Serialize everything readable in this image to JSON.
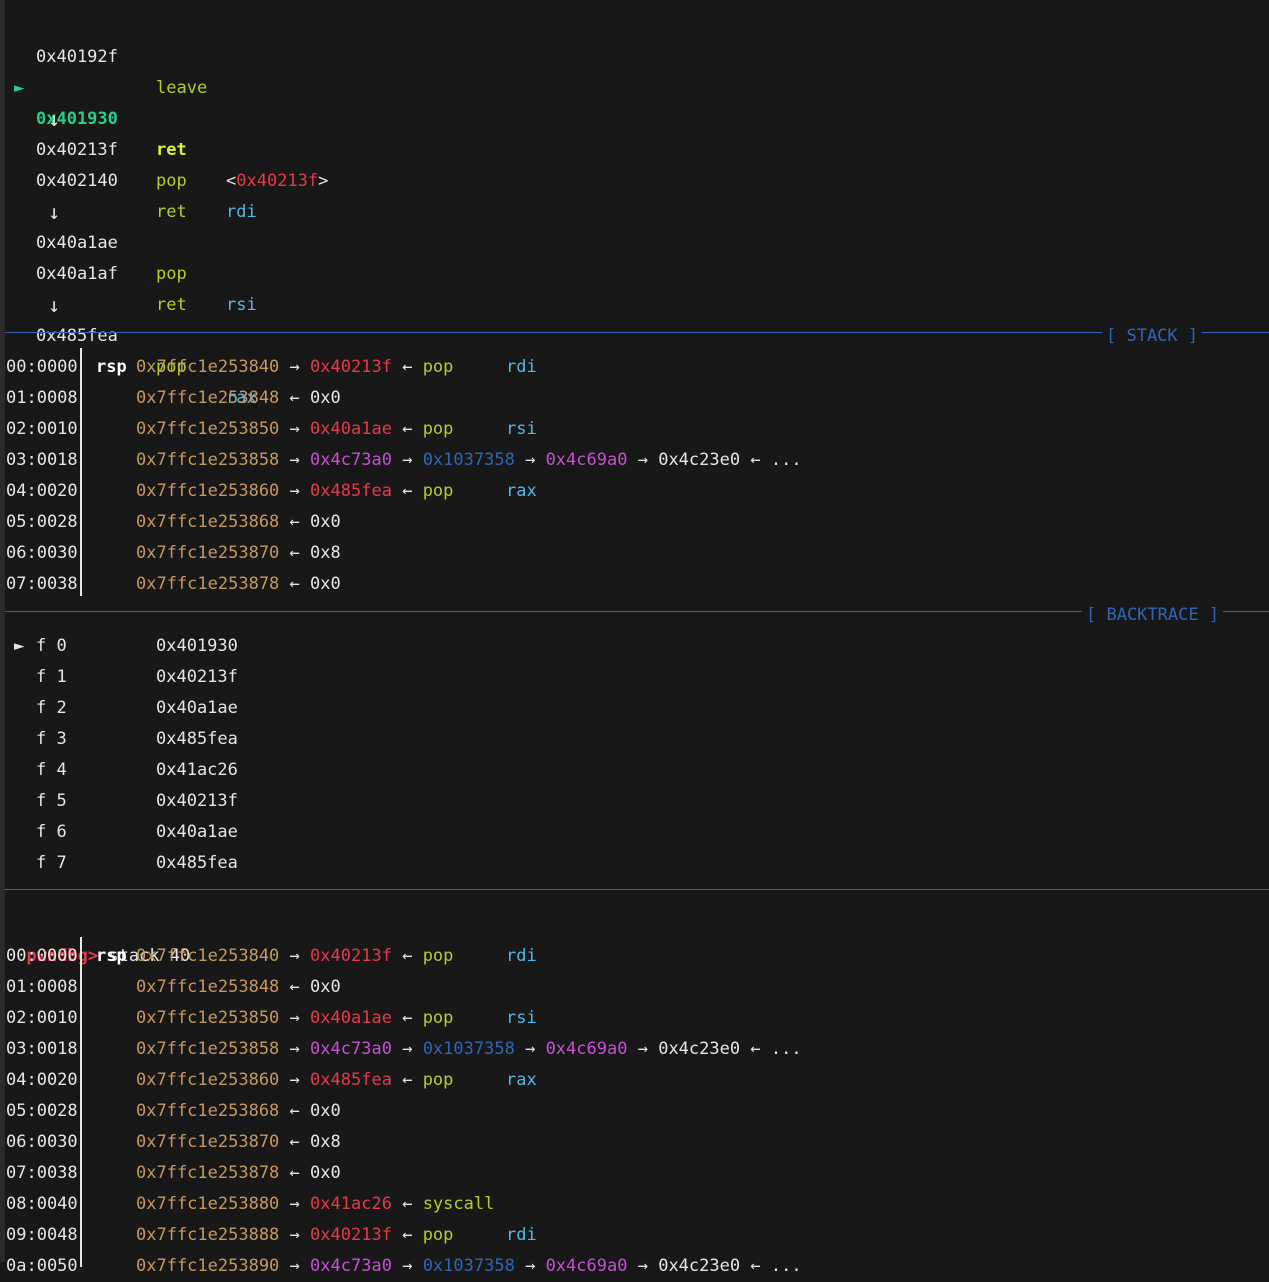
{
  "disasm": [
    {
      "addr": "0x40192f",
      "mnemonic": "leave",
      "operand": "",
      "current": false
    },
    {
      "addr": "0x401930",
      "mnemonic": "ret",
      "operand_target": "0x40213f",
      "current": true,
      "marker": "►",
      "lt": "<",
      "gt": ">"
    },
    {
      "arrow": "↓"
    },
    {
      "addr": "0x40213f",
      "mnemonic": "pop",
      "operand": "rdi"
    },
    {
      "addr": "0x402140",
      "mnemonic": "ret",
      "operand": ""
    },
    {
      "arrow": "↓"
    },
    {
      "addr": "0x40a1ae",
      "mnemonic": "pop",
      "operand": "rsi"
    },
    {
      "addr": "0x40a1af",
      "mnemonic": "ret",
      "operand": ""
    },
    {
      "arrow": "↓"
    },
    {
      "addr": "0x485fea",
      "mnemonic": "pop",
      "operand": "rax"
    }
  ],
  "sections": {
    "stack": "[ STACK ]",
    "backtrace": "[ BACKTRACE ]"
  },
  "stack": [
    {
      "off": "00:0000",
      "reg": "rsp",
      "addr": "0x7ffc1e253840",
      "a1": "→",
      "v": "0x40213f",
      "a2": "←",
      "mn": "pop",
      "op": "rdi"
    },
    {
      "off": "01:0008",
      "reg": "",
      "addr": "0x7ffc1e253848",
      "a1": "←",
      "v": "0x0"
    },
    {
      "off": "02:0010",
      "reg": "",
      "addr": "0x7ffc1e253850",
      "a1": "→",
      "v": "0x40a1ae",
      "a2": "←",
      "mn": "pop",
      "op": "rsi"
    },
    {
      "off": "03:0018",
      "reg": "",
      "addr": "0x7ffc1e253858",
      "a1": "→",
      "d1": "0x4c73a0",
      "a2": "→",
      "h1": "0x1037358",
      "a3": "→",
      "d2": "0x4c69a0",
      "a4": "→",
      "p1": "0x4c23e0",
      "a5": "←",
      "tail": "..."
    },
    {
      "off": "04:0020",
      "reg": "",
      "addr": "0x7ffc1e253860",
      "a1": "→",
      "v": "0x485fea",
      "a2": "←",
      "mn": "pop",
      "op": "rax"
    },
    {
      "off": "05:0028",
      "reg": "",
      "addr": "0x7ffc1e253868",
      "a1": "←",
      "v": "0x0"
    },
    {
      "off": "06:0030",
      "reg": "",
      "addr": "0x7ffc1e253870",
      "a1": "←",
      "v": "0x8"
    },
    {
      "off": "07:0038",
      "reg": "",
      "addr": "0x7ffc1e253878",
      "a1": "←",
      "v": "0x0"
    }
  ],
  "backtrace": [
    {
      "marker": "►",
      "idx": "f 0",
      "addr": "0x401930"
    },
    {
      "marker": "",
      "idx": "f 1",
      "addr": "0x40213f"
    },
    {
      "marker": "",
      "idx": "f 2",
      "addr": "0x40a1ae"
    },
    {
      "marker": "",
      "idx": "f 3",
      "addr": "0x485fea"
    },
    {
      "marker": "",
      "idx": "f 4",
      "addr": "0x41ac26"
    },
    {
      "marker": "",
      "idx": "f 5",
      "addr": "0x40213f"
    },
    {
      "marker": "",
      "idx": "f 6",
      "addr": "0x40a1ae"
    },
    {
      "marker": "",
      "idx": "f 7",
      "addr": "0x485fea"
    }
  ],
  "prompt": {
    "label": "pwndbg>",
    "command": "stack 40"
  },
  "stack2": [
    {
      "off": "00:0000",
      "reg": "rsp",
      "addr": "0x7ffc1e253840",
      "a1": "→",
      "v": "0x40213f",
      "a2": "←",
      "mn": "pop",
      "op": "rdi"
    },
    {
      "off": "01:0008",
      "reg": "",
      "addr": "0x7ffc1e253848",
      "a1": "←",
      "v": "0x0"
    },
    {
      "off": "02:0010",
      "reg": "",
      "addr": "0x7ffc1e253850",
      "a1": "→",
      "v": "0x40a1ae",
      "a2": "←",
      "mn": "pop",
      "op": "rsi"
    },
    {
      "off": "03:0018",
      "reg": "",
      "addr": "0x7ffc1e253858",
      "a1": "→",
      "d1": "0x4c73a0",
      "a2": "→",
      "h1": "0x1037358",
      "a3": "→",
      "d2": "0x4c69a0",
      "a4": "→",
      "p1": "0x4c23e0",
      "a5": "←",
      "tail": "..."
    },
    {
      "off": "04:0020",
      "reg": "",
      "addr": "0x7ffc1e253860",
      "a1": "→",
      "v": "0x485fea",
      "a2": "←",
      "mn": "pop",
      "op": "rax"
    },
    {
      "off": "05:0028",
      "reg": "",
      "addr": "0x7ffc1e253868",
      "a1": "←",
      "v": "0x0"
    },
    {
      "off": "06:0030",
      "reg": "",
      "addr": "0x7ffc1e253870",
      "a1": "←",
      "v": "0x8"
    },
    {
      "off": "07:0038",
      "reg": "",
      "addr": "0x7ffc1e253878",
      "a1": "←",
      "v": "0x0"
    },
    {
      "off": "08:0040",
      "reg": "",
      "addr": "0x7ffc1e253880",
      "a1": "→",
      "v": "0x41ac26",
      "a2": "←",
      "mn": "syscall",
      "op": ""
    },
    {
      "off": "09:0048",
      "reg": "",
      "addr": "0x7ffc1e253888",
      "a1": "→",
      "v": "0x40213f",
      "a2": "←",
      "mn": "pop",
      "op": "rdi"
    },
    {
      "off": "0a:0050",
      "reg": "",
      "addr": "0x7ffc1e253890",
      "a1": "→",
      "d1": "0x4c73a0",
      "a2": "→",
      "h1": "0x1037358",
      "a3": "→",
      "d2": "0x4c69a0",
      "a4": "→",
      "p1": "0x4c23e0",
      "a5": "←",
      "tail": "..."
    }
  ]
}
